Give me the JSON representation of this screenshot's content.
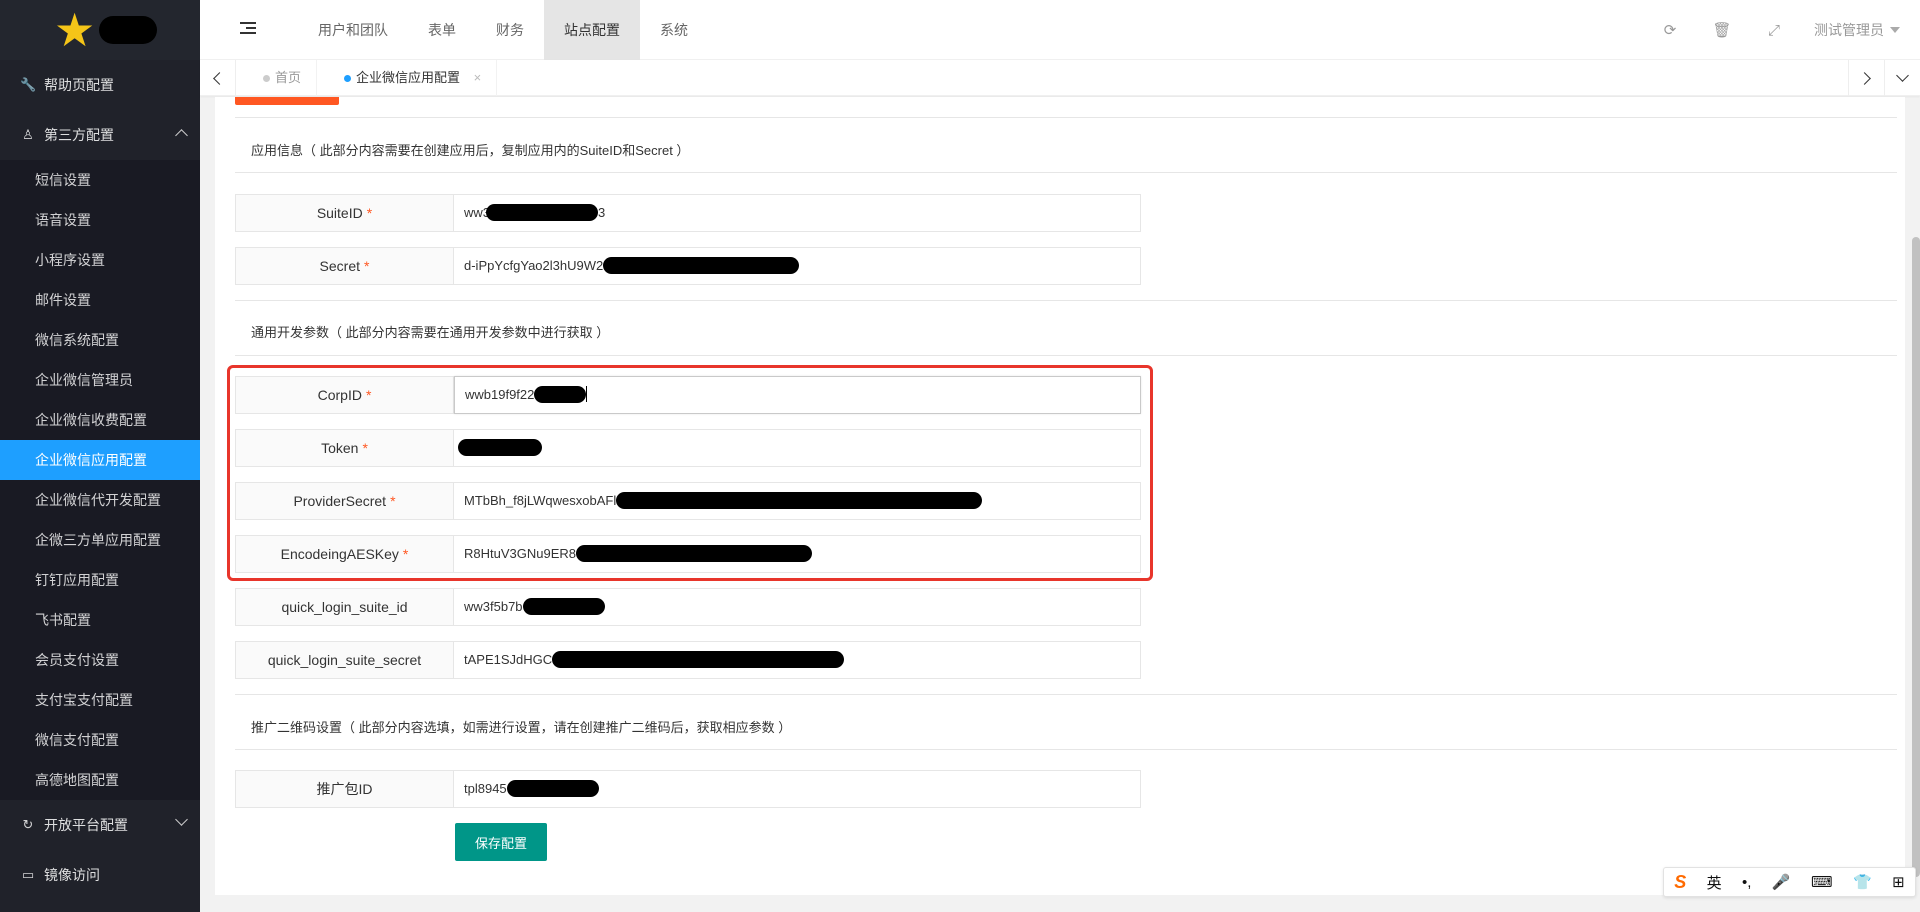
{
  "sidebar": {
    "groups": [
      {
        "label": "帮助页配置",
        "icon": "wrench-icon"
      },
      {
        "label": "第三方配置",
        "icon": "person-icon",
        "expanded": true
      },
      {
        "label": "开放平台配置",
        "icon": "refresh-icon",
        "expanded": false
      },
      {
        "label": "镜像访问",
        "icon": "monitor-icon"
      }
    ],
    "third_party_items": [
      "短信设置",
      "语音设置",
      "小程序设置",
      "邮件设置",
      "微信系统配置",
      "企业微信管理员",
      "企业微信收费配置",
      "企业微信应用配置",
      "企业微信代开发配置",
      "企微三方单应用配置",
      "钉钉应用配置",
      "飞书配置",
      "会员支付设置",
      "支付宝支付配置",
      "微信支付配置",
      "高德地图配置"
    ],
    "active_item": "企业微信应用配置"
  },
  "header": {
    "nav": [
      "用户和团队",
      "表单",
      "财务",
      "站点配置",
      "系统"
    ],
    "active_nav": "站点配置",
    "user": "测试管理员"
  },
  "tabs": [
    {
      "label": "首页",
      "active": false
    },
    {
      "label": "企业微信应用配置",
      "active": true,
      "close": "×"
    }
  ],
  "sections": {
    "app_info": "应用信息（ 此部分内容需要在创建应用后，复制应用内的SuiteID和Secret ）",
    "general": "通用开发参数（ 此部分内容需要在通用开发参数中进行获取 ）",
    "promo": "推广二维码设置（ 此部分内容选填，如需进行设置，请在创建推广二维码后，获取相应参数 ）"
  },
  "fields": {
    "suite_id": {
      "label": "SuiteID",
      "required": "*",
      "value_start": "ww3",
      "value_end": "3"
    },
    "secret": {
      "label": "Secret",
      "required": "*",
      "value": "d-iPpYcfgYao2l3hU9W2"
    },
    "corp_id": {
      "label": "CorpID",
      "required": "*",
      "value": "wwb19f9f22"
    },
    "token": {
      "label": "Token",
      "required": "*",
      "value": ""
    },
    "provider_secret": {
      "label": "ProviderSecret",
      "required": "*",
      "value": "MTbBh_f8jLWqwesxobAFl"
    },
    "aes_key": {
      "label": "EncodeingAESKey",
      "required": "*",
      "value": "R8HtuV3GNu9ER8"
    },
    "quick_suite_id": {
      "label": "quick_login_suite_id",
      "value": "ww3f5b7b"
    },
    "quick_suite_secret": {
      "label": "quick_login_suite_secret",
      "value": "tAPE1SJdHGC"
    },
    "promo_id": {
      "label": "推广包ID",
      "value": "tpl8945"
    }
  },
  "save_label": "保存配置",
  "ime": [
    "英",
    "•,",
    "🎤",
    "⌨",
    "👕",
    "⊞"
  ],
  "colors": {
    "sidebar": "#20222a",
    "active": "#1e9fff",
    "save": "#009688",
    "highlight": "#e8352b",
    "required": "#ff5722"
  }
}
